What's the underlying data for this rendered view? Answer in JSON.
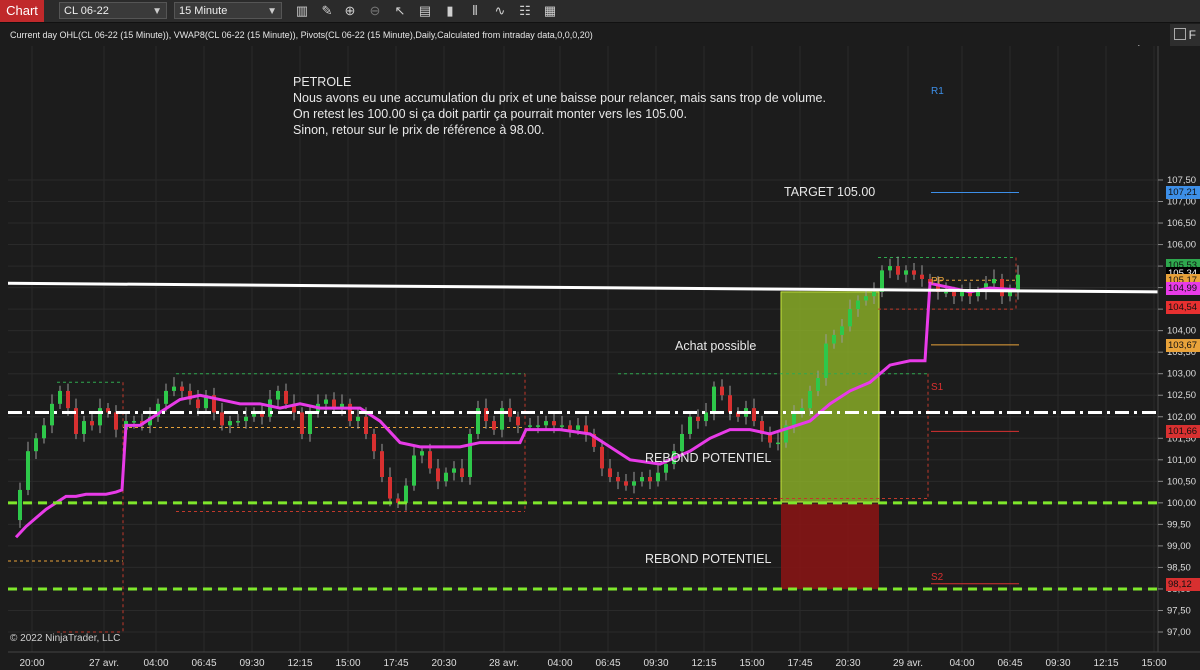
{
  "toolbar": {
    "chart_tab": "Chart",
    "instrument": "CL 06-22",
    "interval": "15 Minute"
  },
  "header": {
    "indicators": "Current day OHL(CL 06-22 (15 Minute)), VWAP8(CL 06-22 (15 Minute)), Pivots(CL 06-22 (15 Minute),Daily,Calculated from intraday data,0,0,0,20)",
    "f_button": "F"
  },
  "note": {
    "title": "PETROLE",
    "line1": "Nous avons eu une accumulation du prix et une baisse pour relancer, mais sans trop de volume.",
    "line2": "On retest les 100.00 si ça doit partir ça pourrait monter vers les 105.00.",
    "line3": "Sinon, retour sur le prix de référence à 98.00."
  },
  "annotations": {
    "target": "TARGET 105.00",
    "achat": "Achat possible",
    "rebond1": "REBOND POTENTIEL",
    "rebond2": "REBOND POTENTIEL"
  },
  "pivots": {
    "r1": "R1",
    "pp": "PP",
    "s1": "S1",
    "s2": "S2"
  },
  "copyright": "© 2022 NinjaTrader, LLC",
  "price_axis": {
    "ticks": [
      "107,50",
      "107,00",
      "106,50",
      "106,00",
      "105,50",
      "105,00",
      "104,50",
      "104,00",
      "103,50",
      "103,00",
      "102,50",
      "102,00",
      "101,50",
      "101,00",
      "100,50",
      "100,00",
      "99,50",
      "99,00",
      "98,50",
      "98,00",
      "97,50",
      "97,00"
    ],
    "labels": [
      {
        "text": "107,21",
        "color": "#3d8fe8"
      },
      {
        "text": "105,53",
        "color": "#2ea84e"
      },
      {
        "text": "105,34",
        "color": "#000000"
      },
      {
        "text": "105,17",
        "color": "#e8a23a"
      },
      {
        "text": "104,99",
        "color": "#e83be8"
      },
      {
        "text": "104,54",
        "color": "#e83030"
      },
      {
        "text": "103,67",
        "color": "#e8a23a"
      },
      {
        "text": "101,66",
        "color": "#d83030"
      },
      {
        "text": "98,12",
        "color": "#d83030"
      }
    ]
  },
  "time_axis": [
    "20:00",
    "27 avr.",
    "04:00",
    "06:45",
    "09:30",
    "12:15",
    "15:00",
    "17:45",
    "20:30",
    "28 avr.",
    "04:00",
    "06:45",
    "09:30",
    "12:15",
    "15:00",
    "17:45",
    "20:30",
    "29 avr.",
    "04:00",
    "06:45",
    "09:30",
    "12:15",
    "15:00"
  ],
  "chart_data": {
    "type": "candlestick",
    "instrument": "CL 06-22",
    "interval": "15 Minute",
    "ylim": [
      96.75,
      108.0
    ],
    "levels": {
      "target": 105.0,
      "achat_possible": 102.1,
      "rebond_1": 100.0,
      "rebond_2": 98.0,
      "R1": 107.21,
      "PP": 103.67,
      "S1": 101.66,
      "S2": 98.12
    },
    "vwap": [
      99.2,
      99.6,
      100.1,
      100.1,
      100.15,
      101.8,
      101.8,
      101.9,
      102.4,
      102.5,
      102.4,
      102.3,
      102.3,
      102.2,
      102.2,
      102.2,
      101.9,
      101.4,
      101.3,
      101.3,
      101.3,
      101.6,
      101.7,
      101.7,
      101.5,
      101.3,
      100.8,
      100.6,
      100.8,
      101.4,
      101.7,
      101.6,
      101.8,
      102.8,
      103.3,
      103.5,
      103.5,
      104.9,
      104.9,
      104.95,
      104.99
    ],
    "green_zone": [
      100.02,
      104.9
    ],
    "red_zone": [
      98.0,
      99.98
    ]
  }
}
